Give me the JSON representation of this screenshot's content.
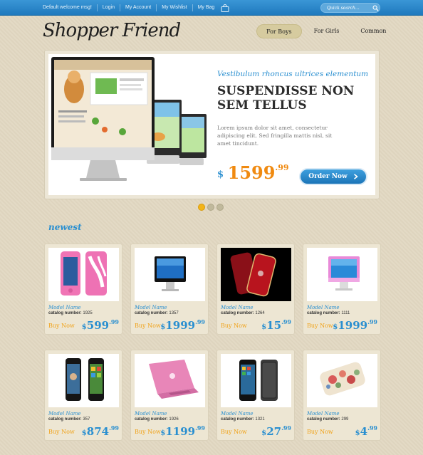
{
  "topbar": {
    "links": [
      "Default welcome msg!",
      "Login",
      "My Account",
      "My Wishlist",
      "My Bag"
    ],
    "search_placeholder": "Quick search...",
    "bg_color": "#2a8ad0"
  },
  "header": {
    "logo": "Shopper Friend",
    "nav": [
      "For Boys",
      "For Girls",
      "Common"
    ],
    "active_nav": "For Boys"
  },
  "slider": {
    "subtitle": "Vestibulum rhoncus ultrices elementum",
    "title": "SUSPENDISSE NON SEM TELLUS",
    "text": "Lorem ipsum dolor sit amet, consectetur adipiscing elit. Sed fringilla mattis nisl, sit amet tincidunt.",
    "currency": "$",
    "price_main": "1599",
    "price_cents": ".99",
    "button": "Order Now",
    "image": "imac-screens",
    "dots_total": 3,
    "active_dot": 1
  },
  "section": {
    "title": "newest"
  },
  "products": [
    {
      "name": "Model Name",
      "catalog_label": "catalog number:",
      "catalog": "1925",
      "buy": "Buy Now",
      "currency": "$",
      "price": "599",
      "cents": ".99",
      "image": "pink-phone-case"
    },
    {
      "name": "Model Name",
      "catalog_label": "catalog number:",
      "catalog": "1357",
      "buy": "Buy Now",
      "currency": "$",
      "price": "1999",
      "cents": ".99",
      "image": "black-imac"
    },
    {
      "name": "Model Name",
      "catalog_label": "catalog number:",
      "catalog": "1264",
      "buy": "Buy Now",
      "currency": "$",
      "price": "15",
      "cents": ".99",
      "image": "red-iphones"
    },
    {
      "name": "Model Name",
      "catalog_label": "catalog number:",
      "catalog": "1111",
      "buy": "Buy Now",
      "currency": "$",
      "price": "1999",
      "cents": ".99",
      "image": "pink-imac"
    },
    {
      "name": "Model Name",
      "catalog_label": "catalog number:",
      "catalog": "357",
      "buy": "Buy Now",
      "currency": "$",
      "price": "874",
      "cents": ".99",
      "image": "iphone-pair"
    },
    {
      "name": "Model Name",
      "catalog_label": "catalog number:",
      "catalog": "1926",
      "buy": "Buy Now",
      "currency": "$",
      "price": "1199",
      "cents": ".99",
      "image": "pink-macbook"
    },
    {
      "name": "Model Name",
      "catalog_label": "catalog number:",
      "catalog": "1321",
      "buy": "Buy Now",
      "currency": "$",
      "price": "27",
      "cents": ".99",
      "image": "iphone-black-case"
    },
    {
      "name": "Model Name",
      "catalog_label": "catalog number:",
      "catalog": "299",
      "buy": "Buy Now",
      "currency": "$",
      "price": "4",
      "cents": ".99",
      "image": "floral-case"
    }
  ]
}
